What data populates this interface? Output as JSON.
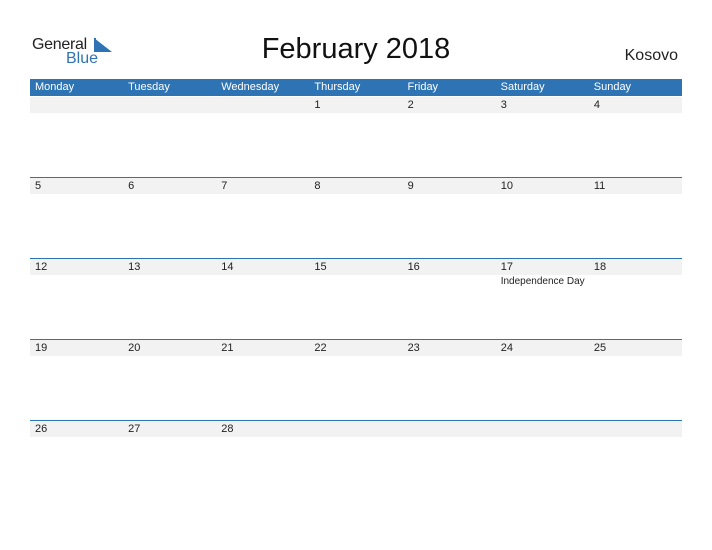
{
  "logo": {
    "word1": "General",
    "word2": "Blue",
    "accent_color": "#2e74b5"
  },
  "title": "February 2018",
  "country": "Kosovo",
  "weekdays": [
    "Monday",
    "Tuesday",
    "Wednesday",
    "Thursday",
    "Friday",
    "Saturday",
    "Sunday"
  ],
  "weeks": [
    {
      "days": [
        {
          "num": ""
        },
        {
          "num": ""
        },
        {
          "num": ""
        },
        {
          "num": "1"
        },
        {
          "num": "2"
        },
        {
          "num": "3"
        },
        {
          "num": "4"
        }
      ]
    },
    {
      "days": [
        {
          "num": "5"
        },
        {
          "num": "6"
        },
        {
          "num": "7"
        },
        {
          "num": "8"
        },
        {
          "num": "9"
        },
        {
          "num": "10"
        },
        {
          "num": "11"
        }
      ]
    },
    {
      "days": [
        {
          "num": "12"
        },
        {
          "num": "13"
        },
        {
          "num": "14"
        },
        {
          "num": "15"
        },
        {
          "num": "16"
        },
        {
          "num": "17",
          "event": "Independence Day"
        },
        {
          "num": "18"
        }
      ]
    },
    {
      "days": [
        {
          "num": "19"
        },
        {
          "num": "20"
        },
        {
          "num": "21"
        },
        {
          "num": "22"
        },
        {
          "num": "23"
        },
        {
          "num": "24"
        },
        {
          "num": "25"
        }
      ]
    },
    {
      "days": [
        {
          "num": "26"
        },
        {
          "num": "27"
        },
        {
          "num": "28"
        },
        {
          "num": ""
        },
        {
          "num": ""
        },
        {
          "num": ""
        },
        {
          "num": ""
        }
      ]
    }
  ],
  "colors": {
    "header_bg": "#2e74b5",
    "date_strip": "#f2f2f2",
    "row_line": "#2e74b5"
  }
}
